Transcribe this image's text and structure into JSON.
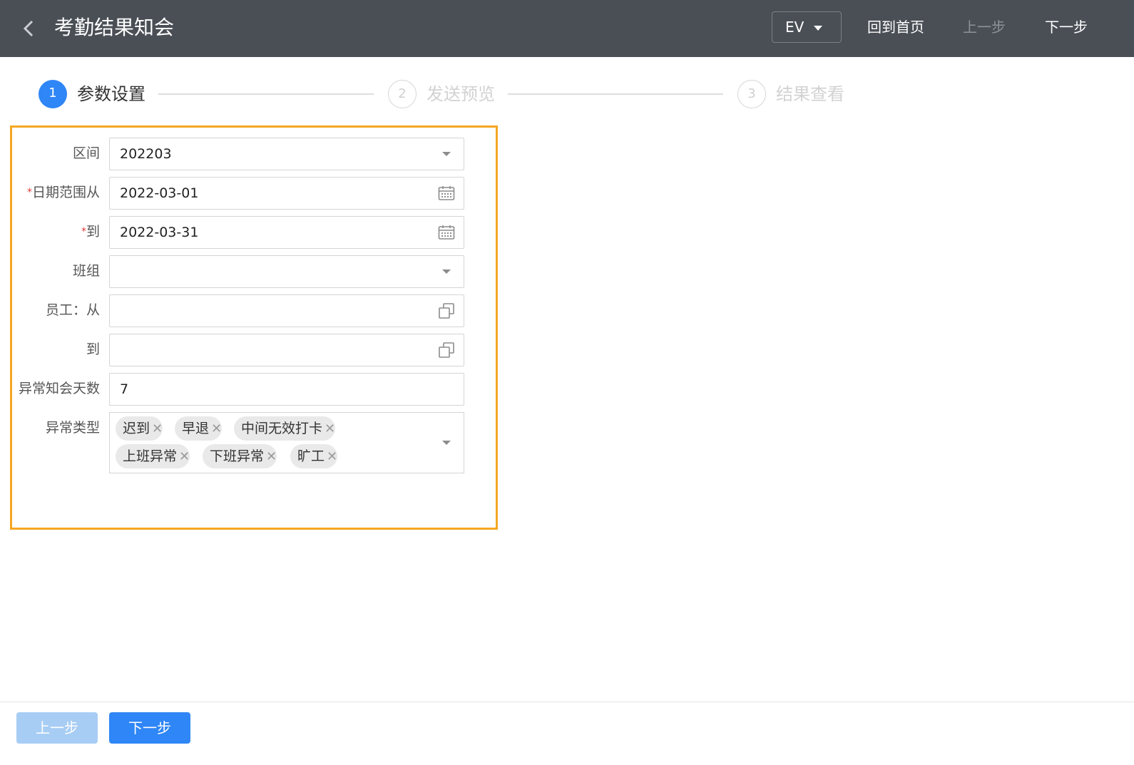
{
  "header": {
    "title": "考勤结果知会",
    "language": "EV",
    "home_label": "回到首页",
    "prev_label": "上一步",
    "next_label": "下一步"
  },
  "steps": [
    {
      "num": "1",
      "label": "参数设置",
      "state": "active"
    },
    {
      "num": "2",
      "label": "发送预览",
      "state": "inactive"
    },
    {
      "num": "3",
      "label": "结果查看",
      "state": "inactive"
    }
  ],
  "form": {
    "period": {
      "label": "区间",
      "value": "202203"
    },
    "date_from": {
      "required_mark": "*",
      "label": "日期范围从",
      "value": "2022-03-01"
    },
    "date_to": {
      "required_mark": "*",
      "label": "到",
      "value": "2022-03-31"
    },
    "team": {
      "label": "班组",
      "value": ""
    },
    "employee_from": {
      "label": "员工：从",
      "value": ""
    },
    "employee_to": {
      "label": "到",
      "value": ""
    },
    "notice_days": {
      "label": "异常知会天数",
      "value": "7"
    },
    "exception_type": {
      "label": "异常类型",
      "tags": [
        "迟到",
        "早退",
        "中间无效打卡",
        "上班异常",
        "下班异常",
        "旷工"
      ]
    }
  },
  "footer": {
    "prev_label": "上一步",
    "next_label": "下一步"
  },
  "colors": {
    "header_bg": "#4a4f56",
    "primary": "#2f86f6",
    "highlight_border": "#f5a623"
  }
}
